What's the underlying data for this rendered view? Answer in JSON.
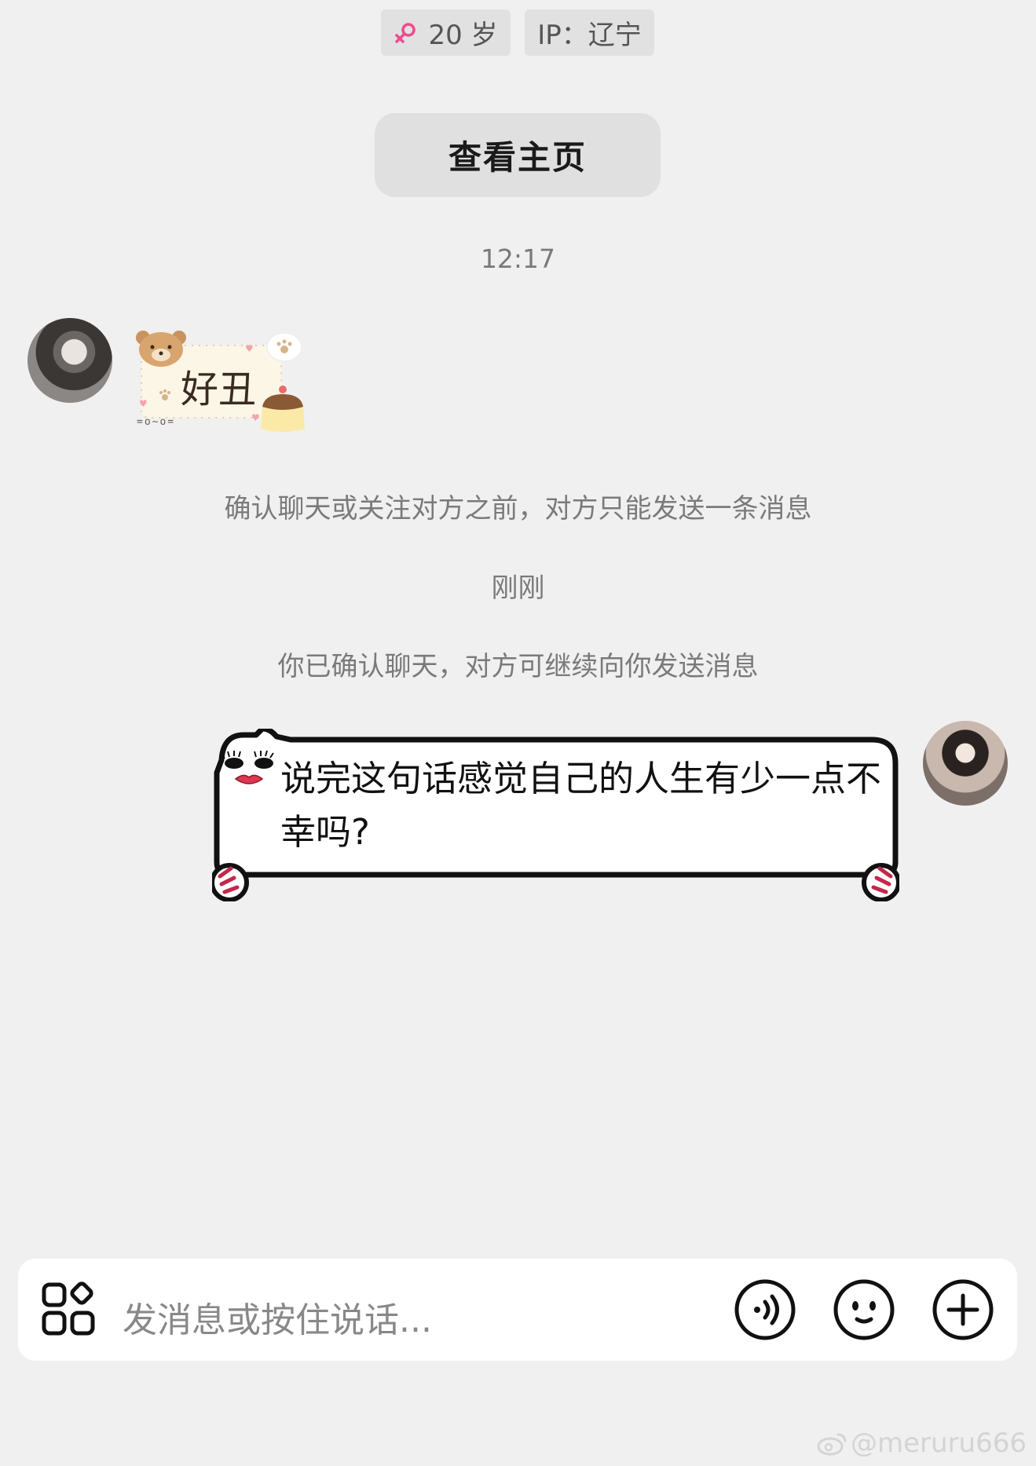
{
  "header": {
    "age_label": "20 岁",
    "ip_label": "IP：辽宁",
    "profile_button": "查看主页",
    "colors": {
      "gender_icon": "#ee4a8c"
    },
    "gender_icon": "female-icon"
  },
  "messages": {
    "timestamp_1": "12:17",
    "sticker_text": "好丑",
    "sticker_caption": "=o~o=",
    "system_notice_1": "确认聊天或关注对方之前，对方只能发送一条消息",
    "timestamp_2": "刚刚",
    "system_notice_2": "你已确认聊天，对方可继续向你发送消息",
    "my_message": "说完这句话感觉自己的人生有少一点不幸吗?"
  },
  "input": {
    "placeholder": "发消息或按住说话...",
    "icons": [
      "apps-icon",
      "voice-icon",
      "emoji-icon",
      "plus-icon"
    ]
  },
  "watermark": "@meruru666"
}
